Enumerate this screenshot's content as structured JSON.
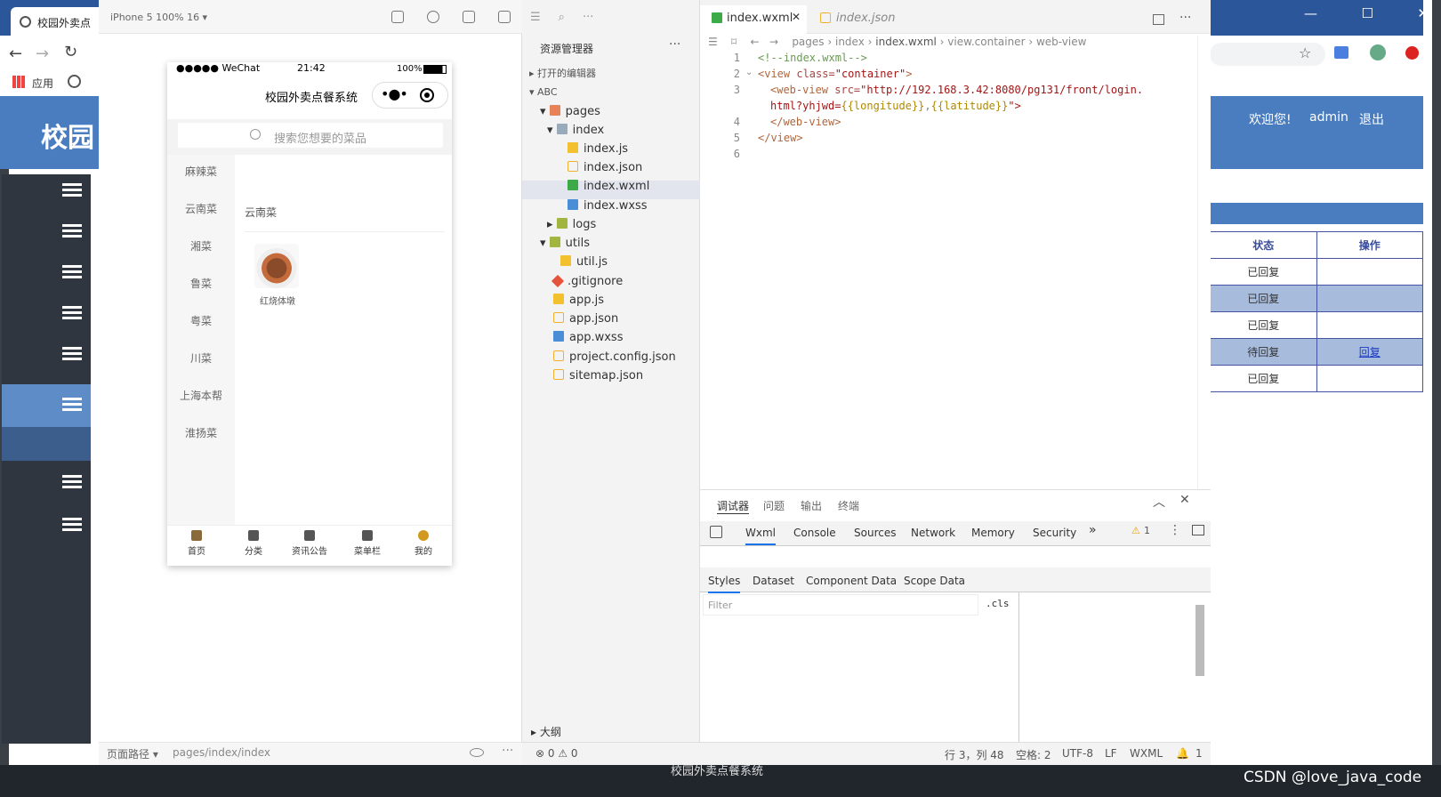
{
  "browser": {
    "tab_title": "校园外卖点",
    "bookmark_apps": "应用"
  },
  "app": {
    "title": "校园",
    "welcome": "欢迎您!",
    "user": "admin",
    "logout": "退出",
    "table": {
      "headers": [
        "状态",
        "操作"
      ],
      "rows": [
        {
          "status": "已回复",
          "action": ""
        },
        {
          "status": "已回复",
          "action": ""
        },
        {
          "status": "已回复",
          "action": ""
        },
        {
          "status": "待回复",
          "action": "回复"
        },
        {
          "status": "已回复",
          "action": ""
        }
      ]
    }
  },
  "simulator": {
    "device": "iPhone 5 100% 16 ▾",
    "phone": {
      "carrier": "●●●●● WeChat",
      "time": "21:42",
      "battery": "100%",
      "nav_title": "校园外卖点餐系统",
      "search_placeholder": "搜索您想要的菜品",
      "categories": [
        "麻辣菜",
        "云南菜",
        "湘菜",
        "鲁菜",
        "粤菜",
        "川菜",
        "上海本帮",
        "淮扬菜"
      ],
      "section_title": "云南菜",
      "dish_name": "红烧体墩",
      "tabs": [
        "首页",
        "分类",
        "资讯公告",
        "菜单栏",
        "我的"
      ]
    },
    "footer_path_label": "页面路径 ▾",
    "footer_path": "pages/index/index"
  },
  "explorer": {
    "title": "资源管理器",
    "open_editors": "打开的编辑器",
    "project": "ABC",
    "items": [
      {
        "label": "pages",
        "type": "folder"
      },
      {
        "label": "index",
        "type": "folder2"
      },
      {
        "label": "index.js",
        "type": "js"
      },
      {
        "label": "index.json",
        "type": "json"
      },
      {
        "label": "index.wxml",
        "type": "wxml"
      },
      {
        "label": "index.wxss",
        "type": "wxss"
      },
      {
        "label": "logs",
        "type": "log"
      },
      {
        "label": "utils",
        "type": "log"
      },
      {
        "label": "util.js",
        "type": "js"
      },
      {
        "label": ".gitignore",
        "type": "git"
      },
      {
        "label": "app.js",
        "type": "js"
      },
      {
        "label": "app.json",
        "type": "json"
      },
      {
        "label": "app.wxss",
        "type": "wxss"
      },
      {
        "label": "project.config.json",
        "type": "json"
      },
      {
        "label": "sitemap.json",
        "type": "json"
      }
    ],
    "outline": "大纲",
    "errors": "⊗ 0 ⚠ 0"
  },
  "editor": {
    "tab_active": "index.wxml",
    "tab_inactive": "index.json",
    "breadcrumbs": [
      "pages",
      "index",
      "index.wxml",
      "view.container",
      "web-view"
    ],
    "line_numbers": [
      "1",
      "2",
      "3",
      "",
      "4",
      "5",
      "6"
    ],
    "code": {
      "l1": "<!--index.wxml-->",
      "l2_open": "<view ",
      "l2_attr": "class=",
      "l2_val": "\"container\"",
      "l2_close": ">",
      "l3_tag": "<web-view ",
      "l3_attr": "src=",
      "l3_val": "\"http://192.168.3.42:8080/pg131/front/login.",
      "l3b_val": "html?yhjwd=",
      "l3b_b1": "{{longitude}}",
      "l3b_sep": ",",
      "l3b_b2": "{{latitude}}",
      "l3b_end": "\">",
      "l4": "</web-view>",
      "l5": "</view>"
    }
  },
  "panel": {
    "tabs": [
      "调试器",
      "问题",
      "输出",
      "终端"
    ],
    "devtools_tabs": [
      "Wxml",
      "Console",
      "Sources",
      "Network",
      "Memory",
      "Security",
      "»"
    ],
    "warnings": "1",
    "sub_tabs": [
      "Styles",
      "Dataset",
      "Component Data",
      "Scope Data"
    ],
    "filter_placeholder": "Filter",
    "cls": ".cls"
  },
  "statusbar": {
    "position": "行 3，列 48",
    "spaces": "空格: 2",
    "encoding": "UTF-8",
    "eol": "LF",
    "language": "WXML",
    "notifications": "1"
  },
  "taskbar_title": "校园外卖点餐系统",
  "watermark": "CSDN @love_java_code"
}
